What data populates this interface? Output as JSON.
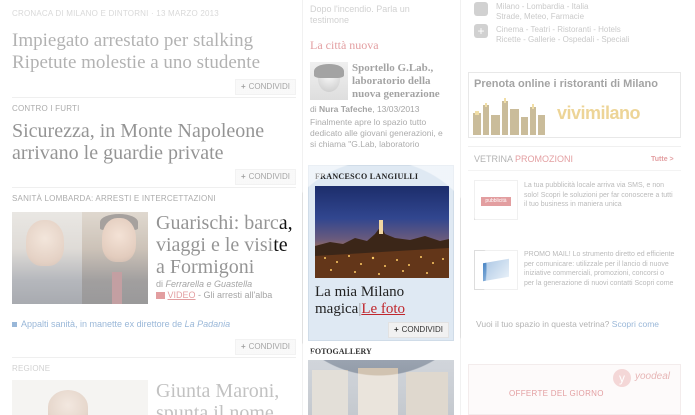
{
  "left": {
    "top_kicker": "CRONACA DI MILANO E DINTORNI · 13 MARZO 2013",
    "story1_title_1": "Impiegato arrestato per stalking",
    "story1_title_2": "Ripetute molestie a uno studente",
    "share_label": "CONDIVIDI",
    "story2_kicker": "CONTRO I FURTI",
    "story2_title_1": "Sicurezza, in Monte Napoleone",
    "story2_title_2": "arrivano le guardie private",
    "story3_kicker": "SANITÀ LOMBARDA: ARRESTI E INTERCETTAZIONI",
    "story3_title_1": "Guarischi: barca,",
    "story3_title_2": "viaggi e le visite",
    "story3_title_3": "a Formigoni",
    "story3_byline_prefix": "di",
    "story3_authors": "Ferrarella e Guastella",
    "story3_video_label": "VIDEO",
    "story3_video_tail": "- Gli arresti all'alba",
    "story3_related_text": "Appalti sanità, in manette ex direttore de",
    "story3_related_paper": "La Padania",
    "story4_kicker": "REGIONE",
    "story4_title_1": "Giunta Maroni,",
    "story4_title_2": "spunta il nome"
  },
  "mid": {
    "top_text_1": "Dopo l'incendio. Parla un",
    "top_text_2": "testimone",
    "section_title": "La città nuova",
    "feature_title_1": "Sportello G.Lab.,",
    "feature_title_2": "laboratorio della",
    "feature_title_3": "nuova generazione",
    "feature_byline_prefix": "di",
    "feature_author": "Nura Tafeche",
    "feature_date": ", 13/03/2013",
    "feature_text_1": "Finalmente apre lo spazio tutto",
    "feature_text_2": "dedicato alle giovani generazioni, e",
    "feature_text_3": "si chiama \"G.Lab, laboratorio",
    "highlight_author": "FRANCESCO LANGIULLI",
    "highlight_title_1": "La mia Milano",
    "highlight_title_2": "magica",
    "highlight_separator": "|",
    "highlight_link": "Le foto",
    "fotogallery_title": "FOTOGALLERY"
  },
  "right": {
    "link1": "Milano - Lombardia - Italia",
    "link2": "Strade, Meteo, Farmacie",
    "links_row1": "Cinema - Teatri - Ristoranti - Hotels",
    "links_row2": "Ricette - Gallerie - Ospedali - Speciali",
    "banner_title_pre": "Prenota online i ",
    "banner_title_bold": "ristoranti",
    "banner_title_post": " di Milano",
    "banner_logo": "vivimilano",
    "vetrina_title_1": "VETRINA ",
    "vetrina_title_2": "PROMOZIONI",
    "vetrina_all": "Tutte >",
    "promo1_logo": "pubblicità",
    "promo1_text": "La tua pubblicità locale arriva via SMS, e non solo! Scopri le soluzioni per far conoscere a tutti il tuo business in maniera unica",
    "promo2_text": "PROMO MAIL! Lo strumento diretto ed efficiente per comunicare: utilizzale per il lancio di nuove iniziative commerciali, promozioni, concorsi o per la generazione di nuovi contatti Scopri come",
    "vetrina_question": "Vuoi il tuo spazio in questa vetrina?",
    "vetrina_cta": "Scopri come",
    "offerte_title": "OFFERTE DEL GIORNO",
    "offerte_logo": "yoodeal"
  },
  "colors": {
    "accent_red": "#c0272d",
    "link_blue": "#1d5fa8",
    "highlight_bg": "#dfe9f3"
  }
}
